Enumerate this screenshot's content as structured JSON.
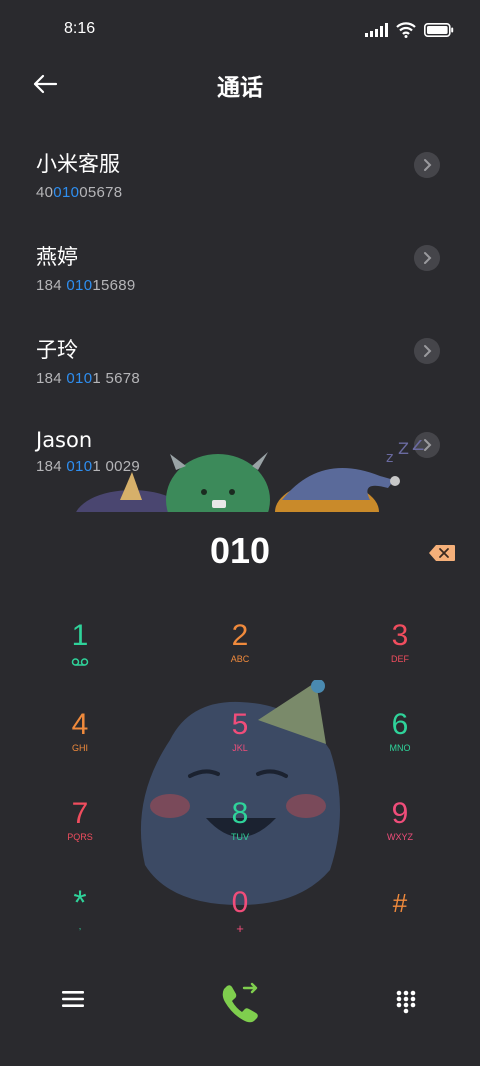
{
  "status_bar": {
    "time": "8:16"
  },
  "header": {
    "title": "通话"
  },
  "contacts": [
    {
      "name": "小米客服",
      "num_pre": "40",
      "num_hl": "010",
      "num_post": "05678"
    },
    {
      "name": "燕婷",
      "num_pre": "184 ",
      "num_hl": "010",
      "num_post": "15689"
    },
    {
      "name": "子玲",
      "num_pre": "184 ",
      "num_hl": "010",
      "num_post": "1 5678"
    },
    {
      "name": "Jason",
      "num_pre": "184 ",
      "num_hl": "010",
      "num_post": "1 0029"
    }
  ],
  "dial": {
    "digits": "010"
  },
  "keys": [
    {
      "digit": "1",
      "letters": "",
      "color": "#2fd39a"
    },
    {
      "digit": "2",
      "letters": "ABC",
      "color": "#f08a3c"
    },
    {
      "digit": "3",
      "letters": "DEF",
      "color": "#f04d5e"
    },
    {
      "digit": "4",
      "letters": "GHI",
      "color": "#f08a3c"
    },
    {
      "digit": "5",
      "letters": "JKL",
      "color": "#f04d7a"
    },
    {
      "digit": "6",
      "letters": "MNO",
      "color": "#2fd39a"
    },
    {
      "digit": "7",
      "letters": "PQRS",
      "color": "#f04d5e"
    },
    {
      "digit": "8",
      "letters": "TUV",
      "color": "#2fd39a"
    },
    {
      "digit": "9",
      "letters": "WXYZ",
      "color": "#f04d7a"
    },
    {
      "digit": "*",
      "letters": ",",
      "color": "#2fd39a"
    },
    {
      "digit": "0",
      "letters": "+",
      "color": "#f04d7a"
    },
    {
      "digit": "#",
      "letters": "",
      "color": "#f08a3c"
    }
  ],
  "colors": {
    "background": "#2a2a2e",
    "highlight": "#2e8ef0",
    "call": "#7fce4e",
    "delete": "#f5b07a"
  }
}
